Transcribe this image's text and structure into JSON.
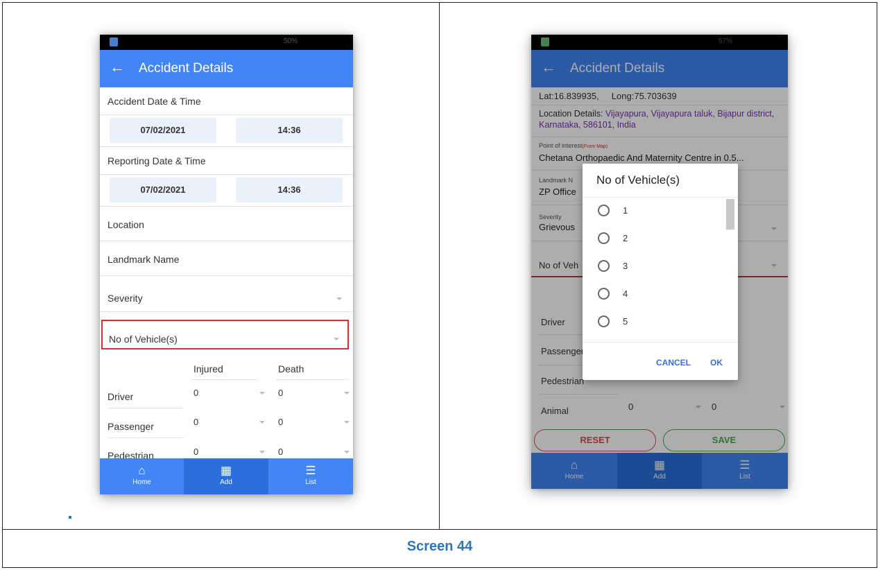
{
  "caption": "Screen 44",
  "phone1": {
    "battery": "50%",
    "title": "Accident Details",
    "accident_label": "Accident Date & Time",
    "accident_date": "07/02/2021",
    "accident_time": "14:36",
    "reporting_label": "Reporting Date & Time",
    "reporting_date": "07/02/2021",
    "reporting_time": "14:36",
    "location": "Location",
    "landmark": "Landmark Name",
    "severity": "Severity",
    "vehicles": "No of Vehicle(s)",
    "col_injured": "Injured",
    "col_death": "Death",
    "rows": [
      {
        "label": "Driver",
        "injured": "0",
        "death": "0"
      },
      {
        "label": "Passenger",
        "injured": "0",
        "death": "0"
      },
      {
        "label": "Pedestrian",
        "injured": "0",
        "death": "0"
      }
    ],
    "nav": {
      "home": "Home",
      "add": "Add",
      "list": "List"
    }
  },
  "phone2": {
    "battery": "57%",
    "title": "Accident Details",
    "latlong": "Lat:16.839935,     Long:75.703639",
    "location_label": "Location Details: ",
    "location_value": "Vijayapura, Vijayapura taluk, Bijapur district, Karnataka, 586101, India",
    "poi_label": "Point of interest",
    "poi_note": "(From Map)",
    "poi_value": "Chetana Orthopaedic And Maternity Centre in 0.5...",
    "landmark_label": "Landmark N",
    "landmark_value": "ZP Office",
    "severity_label": "Severity",
    "severity_value": "Grievous",
    "vehicles": "No of Veh",
    "rows": [
      {
        "label": "Driver"
      },
      {
        "label": "Passenger"
      },
      {
        "label": "Pedestrian"
      },
      {
        "label": "Animal",
        "injured": "0",
        "death": "0"
      }
    ],
    "dialog": {
      "title": "No of Vehicle(s)",
      "options": [
        "1",
        "2",
        "3",
        "4",
        "5"
      ],
      "cancel": "CANCEL",
      "ok": "OK"
    },
    "reset": "RESET",
    "save": "SAVE",
    "nav": {
      "home": "Home",
      "add": "Add",
      "list": "List"
    },
    "colors": {
      "accent": "#4285f4",
      "location_text": "#7a2fb8",
      "reset": "#d94c4c",
      "save": "#3fae4a"
    }
  }
}
